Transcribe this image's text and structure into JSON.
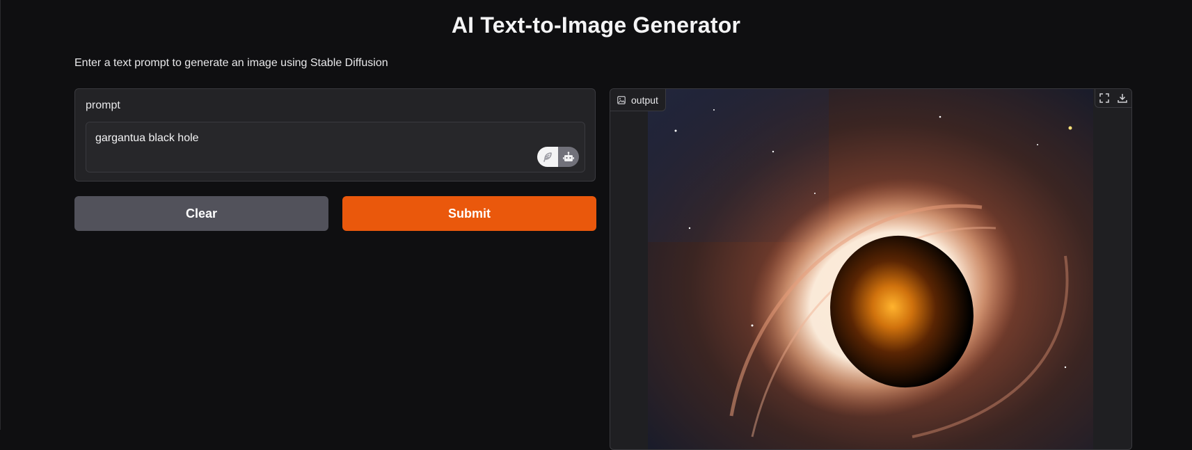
{
  "header": {
    "title": "AI Text-to-Image Generator",
    "description": "Enter a text prompt to generate an image using Stable Diffusion"
  },
  "prompt": {
    "label": "prompt",
    "value": "gargantua black hole"
  },
  "buttons": {
    "clear": "Clear",
    "submit": "Submit"
  },
  "output": {
    "label": "output"
  },
  "colors": {
    "background": "#0f0f11",
    "panel": "#232326",
    "clear_button": "#52525b",
    "submit_button": "#ea580c"
  },
  "icons": {
    "chip_left": "feather-icon",
    "chip_right": "robot-icon",
    "output_label": "image-icon",
    "fullscreen": "fullscreen-icon",
    "download": "download-icon"
  }
}
